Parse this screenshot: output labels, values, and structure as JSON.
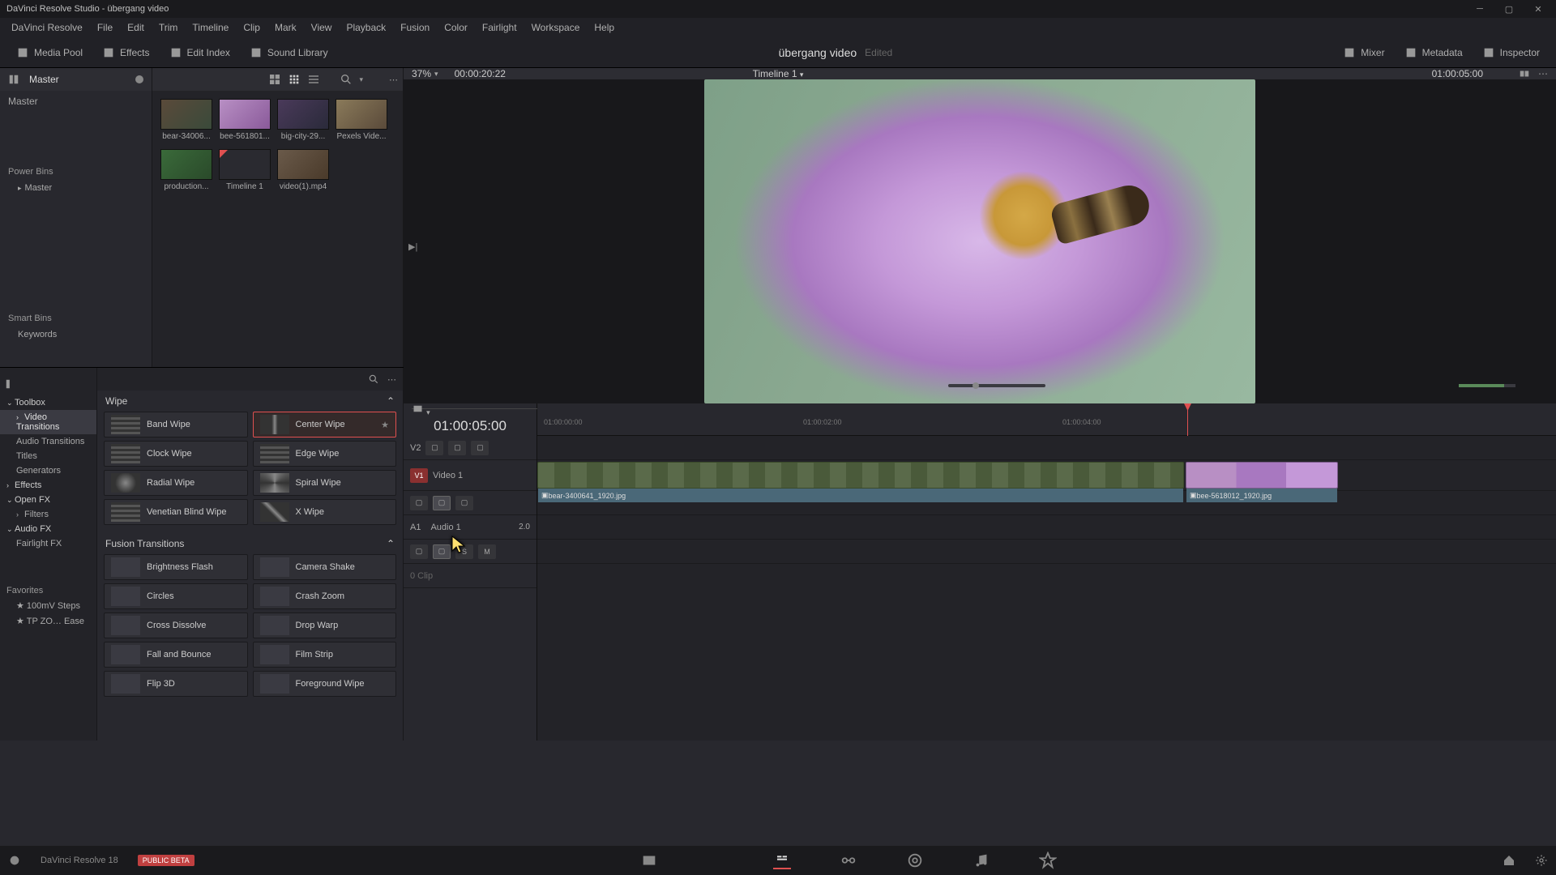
{
  "app": {
    "title": "DaVinci Resolve Studio - übergang video"
  },
  "menu": [
    "DaVinci Resolve",
    "File",
    "Edit",
    "Trim",
    "Timeline",
    "Clip",
    "Mark",
    "View",
    "Playback",
    "Fusion",
    "Color",
    "Fairlight",
    "Workspace",
    "Help"
  ],
  "workspace": {
    "left": [
      {
        "label": "Media Pool",
        "icon": "media-pool"
      },
      {
        "label": "Effects",
        "icon": "effects"
      },
      {
        "label": "Edit Index",
        "icon": "edit-index"
      },
      {
        "label": "Sound Library",
        "icon": "sound"
      }
    ],
    "title": "übergang video",
    "edited": "Edited",
    "right": [
      {
        "label": "Mixer",
        "icon": "mixer"
      },
      {
        "label": "Metadata",
        "icon": "metadata"
      },
      {
        "label": "Inspector",
        "icon": "inspector"
      }
    ]
  },
  "bins": {
    "header": "Master",
    "top": "Master",
    "power": "Power Bins",
    "power_item": "Master",
    "smart": "Smart Bins",
    "smart_item": "Keywords"
  },
  "clips": [
    {
      "name": "bear-34006...",
      "cls": "bear"
    },
    {
      "name": "bee-561801...",
      "cls": "bee"
    },
    {
      "name": "big-city-29...",
      "cls": "city"
    },
    {
      "name": "Pexels Vide...",
      "cls": "pexels"
    },
    {
      "name": "production...",
      "cls": "prod"
    },
    {
      "name": "Timeline 1",
      "cls": "tl"
    },
    {
      "name": "video(1).mp4",
      "cls": "vid"
    }
  ],
  "viewer": {
    "pct": "37%",
    "src_tc": "00:00:20:22",
    "timeline_name": "Timeline 1",
    "rec_tc": "01:00:05:00"
  },
  "fx_tree": {
    "toolbox": "Toolbox",
    "items1": [
      "Video Transitions",
      "Audio Transitions",
      "Titles",
      "Generators"
    ],
    "effects": "Effects",
    "openfx": "Open FX",
    "filters": "Filters",
    "audiofx": "Audio FX",
    "fairlight": "Fairlight FX",
    "favorites": "Favorites",
    "fav_items": [
      "100mV Steps",
      "TP ZO… Ease"
    ]
  },
  "fx_cats": {
    "wipe_title": "Wipe",
    "wipes": [
      {
        "name": "Band Wipe",
        "cls": "bands"
      },
      {
        "name": "Center Wipe",
        "cls": "center",
        "selected": true
      },
      {
        "name": "Clock Wipe",
        "cls": "bands"
      },
      {
        "name": "Edge Wipe",
        "cls": "bands"
      },
      {
        "name": "Radial Wipe",
        "cls": "radial"
      },
      {
        "name": "Spiral Wipe",
        "cls": "spiral"
      },
      {
        "name": "Venetian Blind Wipe",
        "cls": "bands"
      },
      {
        "name": "X Wipe",
        "cls": "x"
      }
    ],
    "fusion_title": "Fusion Transitions",
    "fusions": [
      {
        "name": "Brightness Flash"
      },
      {
        "name": "Camera Shake"
      },
      {
        "name": "Circles"
      },
      {
        "name": "Crash Zoom"
      },
      {
        "name": "Cross Dissolve"
      },
      {
        "name": "Drop Warp"
      },
      {
        "name": "Fall and Bounce"
      },
      {
        "name": "Film Strip"
      },
      {
        "name": "Flip 3D"
      },
      {
        "name": "Foreground Wipe"
      }
    ]
  },
  "timeline": {
    "tc": "01:00:05:00",
    "ticks": [
      "01:00:00:00",
      "01:00:02:00",
      "01:00:04:00"
    ],
    "v2": "V2",
    "v1": "V1",
    "a1": "A1",
    "video1": "Video 1",
    "audio1": "Audio 1",
    "a1_val": "2.0",
    "zero_clip": "0 Clip",
    "clip1": "bear-3400641_1920.jpg",
    "clip2": "bee-5618012_1920.jpg"
  },
  "footer": {
    "version": "DaVinci Resolve 18",
    "beta": "PUBLIC BETA"
  }
}
